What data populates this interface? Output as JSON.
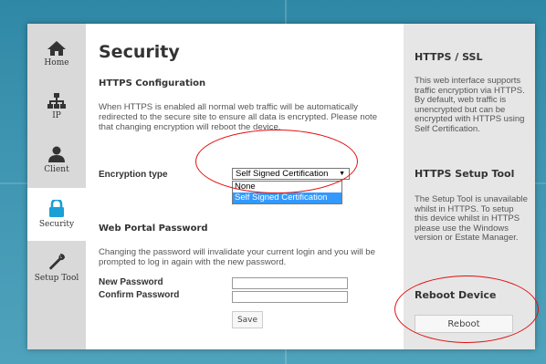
{
  "sidebar": {
    "items": [
      {
        "label": "Home",
        "icon": "home-icon"
      },
      {
        "label": "IP",
        "icon": "network-icon"
      },
      {
        "label": "Client",
        "icon": "user-icon"
      },
      {
        "label": "Security",
        "icon": "lock-icon",
        "active": true
      },
      {
        "label": "Setup Tool",
        "icon": "wrench-icon"
      }
    ]
  },
  "main": {
    "title": "Security",
    "https": {
      "heading": "HTTPS Configuration",
      "description": "When HTTPS is enabled all normal web traffic will be automatically redirected to the secure site to ensure all data is encrypted. Please note that changing encryption will reboot the device.",
      "encryption_label": "Encryption type",
      "selected": "Self Signed Certification",
      "options": [
        "None",
        "Self Signed Certification"
      ]
    },
    "password": {
      "heading": "Web Portal Password",
      "description": "Changing the password will invalidate your current login and you will be prompted to log in again with the new password.",
      "new_label": "New Password",
      "confirm_label": "Confirm Password",
      "save_label": "Save"
    }
  },
  "right_panel": {
    "https_heading": "HTTPS / SSL",
    "https_text": "This web interface supports traffic encryption via HTTPS. By default, web traffic is unencrypted but can be encrypted with HTTPS using Self Certification.",
    "setup_heading": "HTTPS Setup Tool",
    "setup_text": "The Setup Tool is unavailable whilst in HTTPS. To setup this device whilst in HTTPS please use the Windows version or Estate Manager.",
    "reboot_heading": "Reboot Device",
    "reboot_label": "Reboot"
  },
  "colors": {
    "annotation": "#e01010",
    "selection": "#3399ff",
    "background": "#3e95b1"
  }
}
